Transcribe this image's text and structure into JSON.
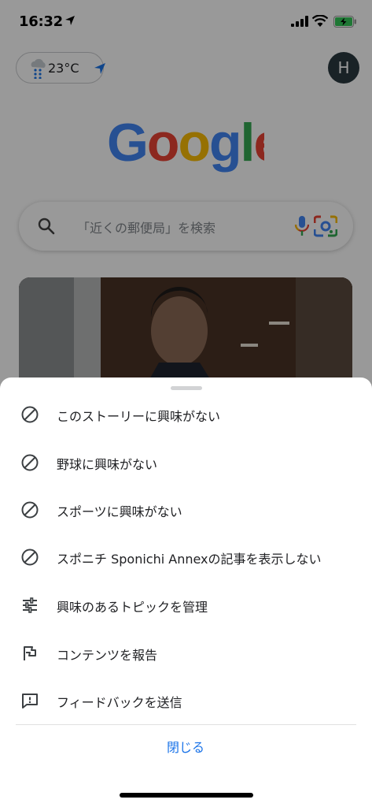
{
  "status_bar": {
    "time": "16:32"
  },
  "weather": {
    "temperature": "23°C"
  },
  "account": {
    "avatar_initial": "H"
  },
  "search": {
    "placeholder": "「近くの郵便局」を検索"
  },
  "colors": {
    "accent": "#1a73e8",
    "dim_overlay": "rgba(0,0,0,0.40)"
  },
  "menu": {
    "items": [
      {
        "icon": "block-icon",
        "label": "このストーリーに興味がない"
      },
      {
        "icon": "block-icon",
        "label": "野球に興味がない"
      },
      {
        "icon": "block-icon",
        "label": "スポーツに興味がない"
      },
      {
        "icon": "block-icon",
        "label": "スポニチ Sponichi Annexの記事を表示しない"
      },
      {
        "icon": "tune-icon",
        "label": "興味のあるトピックを管理"
      },
      {
        "icon": "flag-icon",
        "label": "コンテンツを報告"
      },
      {
        "icon": "feedback-icon",
        "label": "フィードバックを送信"
      }
    ],
    "close_label": "閉じる"
  }
}
